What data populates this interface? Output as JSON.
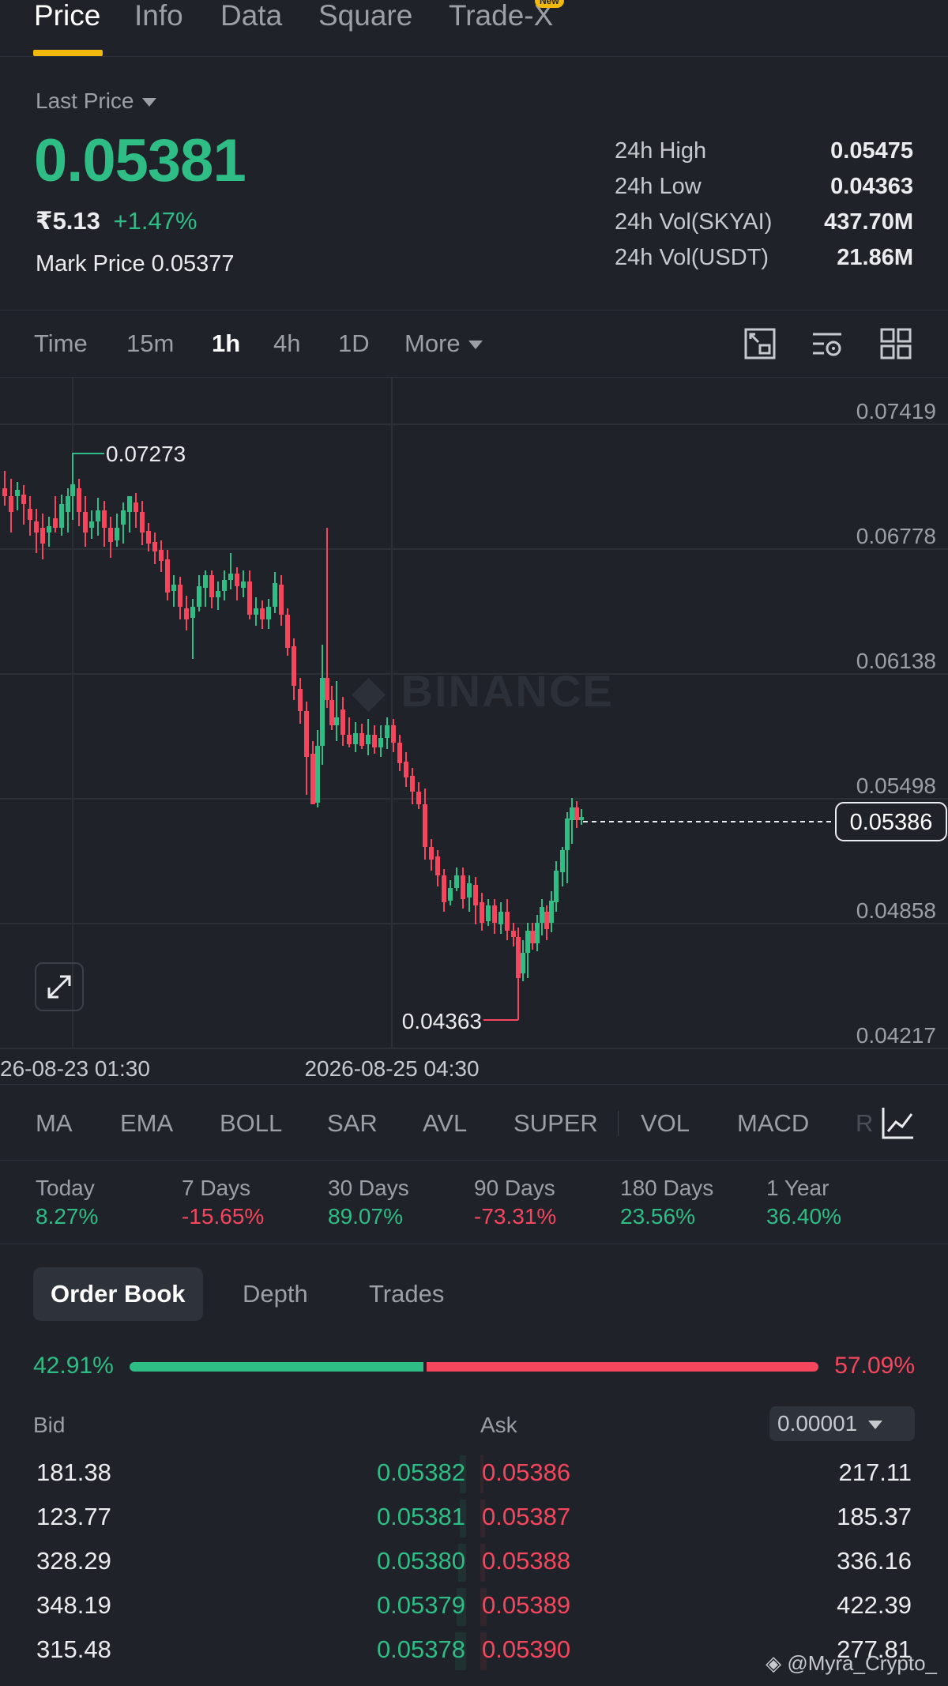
{
  "top_tabs": [
    {
      "label": "Price",
      "active": true
    },
    {
      "label": "Info"
    },
    {
      "label": "Data"
    },
    {
      "label": "Square"
    },
    {
      "label": "Trade-X",
      "badge": "New"
    }
  ],
  "header": {
    "last_price_label": "Last Price",
    "last_price": "0.05381",
    "fiat_price": "₹5.13",
    "change_pct": "+1.47%",
    "mark_price_label": "Mark Price",
    "mark_price": "0.05377"
  },
  "stats": [
    {
      "label": "24h High",
      "value": "0.05475"
    },
    {
      "label": "24h Low",
      "value": "0.04363"
    },
    {
      "label": "24h Vol(SKYAI)",
      "value": "437.70M"
    },
    {
      "label": "24h Vol(USDT)",
      "value": "21.86M"
    }
  ],
  "intervals": [
    {
      "label": "Time"
    },
    {
      "label": "15m"
    },
    {
      "label": "1h",
      "active": true
    },
    {
      "label": "4h"
    },
    {
      "label": "1D"
    },
    {
      "label": "More"
    }
  ],
  "chart": {
    "watermark": "BINANCE",
    "y_ticks": [
      "0.07419",
      "0.06778",
      "0.06138",
      "0.05498",
      "0.04858",
      "0.04217"
    ],
    "current_price_tag": "0.05386",
    "high_marker": "0.07273",
    "low_marker": "0.04363",
    "x_ticks": [
      "26-08-23 01:30",
      "2026-08-25 04:30"
    ]
  },
  "indicators": [
    "MA",
    "EMA",
    "BOLL",
    "SAR",
    "AVL",
    "SUPER",
    "VOL",
    "MACD",
    "R"
  ],
  "performance": [
    {
      "label": "Today",
      "value": "8.27%",
      "dir": "up"
    },
    {
      "label": "7 Days",
      "value": "-15.65%",
      "dir": "down"
    },
    {
      "label": "30 Days",
      "value": "89.07%",
      "dir": "up"
    },
    {
      "label": "90 Days",
      "value": "-73.31%",
      "dir": "down"
    },
    {
      "label": "180 Days",
      "value": "23.56%",
      "dir": "up"
    },
    {
      "label": "1 Year",
      "value": "36.40%",
      "dir": "up"
    }
  ],
  "book_tabs": [
    {
      "label": "Order Book",
      "active": true
    },
    {
      "label": "Depth"
    },
    {
      "label": "Trades"
    }
  ],
  "ratio": {
    "bid_pct": "42.91%",
    "ask_pct": "57.09%"
  },
  "book_header": {
    "bid": "Bid",
    "ask": "Ask",
    "tick_size": "0.00001"
  },
  "book_rows": [
    {
      "bid_qty": "181.38",
      "bid_price": "0.05382",
      "ask_price": "0.05386",
      "ask_qty": "217.11"
    },
    {
      "bid_qty": "123.77",
      "bid_price": "0.05381",
      "ask_price": "0.05387",
      "ask_qty": "185.37"
    },
    {
      "bid_qty": "328.29",
      "bid_price": "0.05380",
      "ask_price": "0.05388",
      "ask_qty": "336.16"
    },
    {
      "bid_qty": "348.19",
      "bid_price": "0.05379",
      "ask_price": "0.05389",
      "ask_qty": "422.39"
    },
    {
      "bid_qty": "315.48",
      "bid_price": "0.05378",
      "ask_price": "0.05390",
      "ask_qty": "277.81"
    }
  ],
  "credit": "@Myra_Crypto_",
  "colors": {
    "up": "#2ebd85",
    "down": "#f6465d",
    "accent": "#f0b90b",
    "bg": "#1f2228"
  }
}
